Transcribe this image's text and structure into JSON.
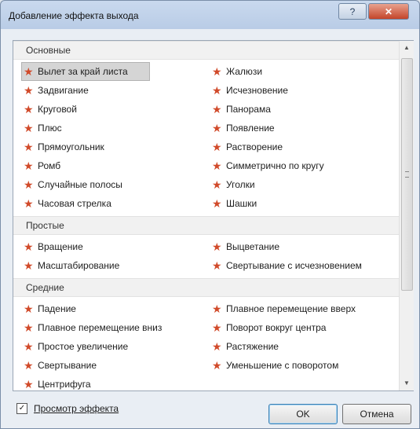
{
  "window": {
    "title": "Добавление эффекта выхода"
  },
  "titlebar": {
    "help_glyph": "?",
    "close_glyph": "✕"
  },
  "icons": {
    "effect_star": "star-icon"
  },
  "colors": {
    "star": "#d14a2a",
    "selection": "#d5d5d5",
    "group_header": "#f1f1f1"
  },
  "groups": [
    {
      "name": "Основные",
      "left": [
        "Вылет за край листа",
        "Задвигание",
        "Круговой",
        "Плюс",
        "Прямоугольник",
        "Ромб",
        "Случайные полосы",
        "Часовая стрелка"
      ],
      "right": [
        "Жалюзи",
        "Исчезновение",
        "Панорама",
        "Появление",
        "Растворение",
        "Симметрично по кругу",
        "Уголки",
        "Шашки"
      ]
    },
    {
      "name": "Простые",
      "left": [
        "Вращение",
        "Масштабирование"
      ],
      "right": [
        "Выцветание",
        "Свертывание с исчезновением"
      ]
    },
    {
      "name": "Средние",
      "left": [
        "Падение",
        "Плавное перемещение вниз",
        "Простое увеличение",
        "Свертывание",
        "Центрифуга"
      ],
      "right": [
        "Плавное перемещение вверх",
        "Поворот вокруг центра",
        "Растяжение",
        "Уменьшение с поворотом"
      ]
    }
  ],
  "selected": "Вылет за край листа",
  "scrollbar": {
    "up": "▲",
    "down": "▼"
  },
  "preview": {
    "label": "Просмотр эффекта",
    "checked": true,
    "check_glyph": "✓"
  },
  "buttons": {
    "ok": "OK",
    "cancel": "Отмена"
  }
}
